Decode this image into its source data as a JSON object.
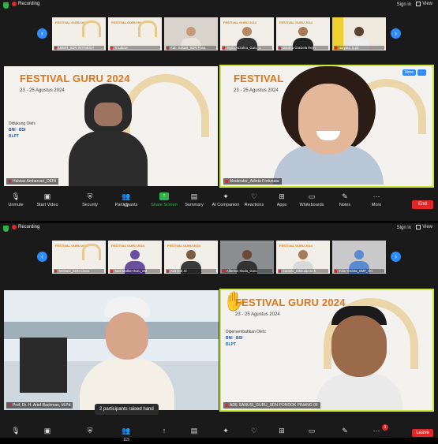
{
  "top": {
    "recording": "Recording",
    "sign_in": "Sign in",
    "view": "View",
    "thumbs": [
      "UMAR_SDN INTINESIA",
      "Ti Lakovi",
      "Kab. Bekasi_SDN Pusa",
      "Tsyifa Azzahra_Guru_1",
      "Dimitha Graciela Rejin",
      "Nuryani, S.pd"
    ],
    "slide_title_small": "FESTIVAL GURU 2024",
    "video_left": {
      "title": "FESTIVAL GURU 2024",
      "dates": "23 - 25 Agustus 2024",
      "supported_by": "Didukung Oleh:",
      "name": "Halvias Ambarsari_DEIN"
    },
    "video_right": {
      "title": "FESTIVAL",
      "dates": "23 - 25 Agustus 2024",
      "name": "Moderator_Adinta Fortunata",
      "more_label": "More"
    },
    "toolbar": {
      "unmute": "Unmute",
      "start_video": "Start Video",
      "security": "Security",
      "participants": "Participants",
      "participants_count": "62",
      "share_screen": "Share Screen",
      "summary": "Summary",
      "ai_companion": "AI Companion",
      "reactions": "Reactions",
      "apps": "Apps",
      "whiteboards": "Whiteboards",
      "notes": "Notes",
      "more": "More",
      "end": "End"
    }
  },
  "bottom": {
    "recording": "Recording",
    "sign_in": "Sign in",
    "view": "View",
    "thumbs": [
      "Tetrivani_SDN Cinea",
      "Tasti Malike-Guru_SM",
      "Azit M.E.Al",
      "Albertus Muda_Guru",
      "Suranto_Dikbudpora K",
      "Yulix Yesinta_SMP_On"
    ],
    "video_left": {
      "name": "Prof. Dr. H. Arief Rachman, M.Pd"
    },
    "video_right": {
      "title": "FESTIVAL GURU 2024",
      "dates": "23 - 25 Agustus 2024",
      "supported_by": "Dipersembahkan Oleh:",
      "name": "ADE SANUSI_GURU_SDN PONDOK PINANG 06"
    },
    "toast": "2 participants raised hand",
    "toolbar": {
      "participants_count": "115",
      "badge": "1",
      "leave": "Leave"
    }
  }
}
